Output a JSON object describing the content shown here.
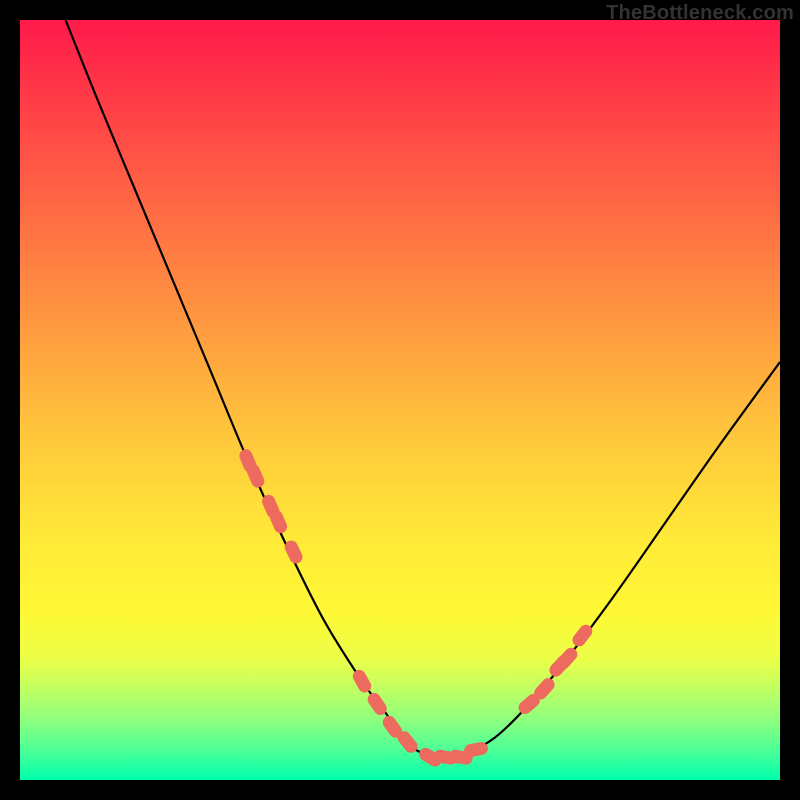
{
  "watermark": "TheBottleneck.com",
  "chart_data": {
    "type": "line",
    "title": "",
    "xlabel": "",
    "ylabel": "",
    "xlim": [
      0,
      100
    ],
    "ylim": [
      0,
      100
    ],
    "series": [
      {
        "name": "bottleneck-curve",
        "x": [
          6,
          10,
          15,
          20,
          25,
          30,
          35,
          40,
          45,
          48,
          50,
          52,
          55,
          58,
          60,
          63,
          67,
          72,
          78,
          85,
          92,
          100
        ],
        "y": [
          100,
          90,
          78,
          66,
          54,
          42,
          31,
          21,
          13,
          9,
          6,
          4,
          3,
          3,
          4,
          6,
          10,
          16,
          24,
          34,
          44,
          55
        ]
      }
    ],
    "markers": {
      "name": "highlight-points",
      "color": "#ec6a5e",
      "x": [
        30,
        31,
        33,
        34,
        36,
        45,
        47,
        49,
        51,
        54,
        56,
        58,
        60,
        67,
        69,
        71,
        72,
        74
      ],
      "y": [
        42,
        40,
        36,
        34,
        30,
        13,
        10,
        7,
        5,
        3,
        3,
        3,
        4,
        10,
        12,
        15,
        16,
        19
      ]
    }
  }
}
